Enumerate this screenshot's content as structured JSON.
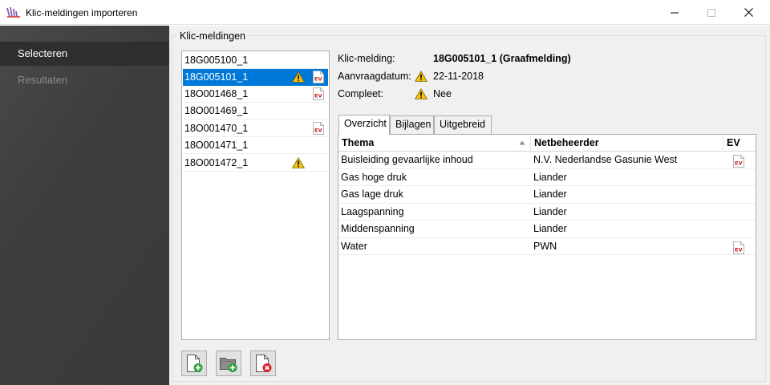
{
  "window": {
    "title": "Klic-meldingen importeren"
  },
  "nav": {
    "items": [
      {
        "label": "Selecteren"
      },
      {
        "label": "Resultaten"
      }
    ]
  },
  "group": {
    "label": "Klic-meldingen"
  },
  "list": {
    "items": [
      {
        "label": "18G005100_1",
        "warning": false,
        "ev": false,
        "selected": false
      },
      {
        "label": "18G005101_1",
        "warning": true,
        "ev": true,
        "selected": true
      },
      {
        "label": "18O001468_1",
        "warning": false,
        "ev": true,
        "selected": false
      },
      {
        "label": "18O001469_1",
        "warning": false,
        "ev": false,
        "selected": false
      },
      {
        "label": "18O001470_1",
        "warning": false,
        "ev": true,
        "selected": false
      },
      {
        "label": "18O001471_1",
        "warning": false,
        "ev": false,
        "selected": false
      },
      {
        "label": "18O001472_1",
        "warning": true,
        "ev": false,
        "selected": false
      }
    ]
  },
  "details": {
    "melding_label": "Klic-melding:",
    "melding_value": "18G005101_1 (Graafmelding)",
    "datum_label": "Aanvraagdatum:",
    "datum_value": "22-11-2018",
    "compleet_label": "Compleet:",
    "compleet_value": "Nee"
  },
  "tabs": [
    {
      "label": "Overzicht",
      "active": true
    },
    {
      "label": "Bijlagen",
      "active": false
    },
    {
      "label": "Uitgebreid",
      "active": false
    }
  ],
  "grid": {
    "columns": [
      {
        "label": "Thema",
        "sorted": "ascending"
      },
      {
        "label": "Netbeheerder"
      },
      {
        "label": "EV"
      }
    ],
    "rows": [
      {
        "thema": "Buisleiding gevaarlijke inhoud",
        "netbeheerder": "N.V. Nederlandse Gasunie West",
        "ev": true
      },
      {
        "thema": "Gas hoge druk",
        "netbeheerder": "Liander",
        "ev": false
      },
      {
        "thema": "Gas lage druk",
        "netbeheerder": "Liander",
        "ev": false
      },
      {
        "thema": "Laagspanning",
        "netbeheerder": "Liander",
        "ev": false
      },
      {
        "thema": "Middenspanning",
        "netbeheerder": "Liander",
        "ev": false
      },
      {
        "thema": "Water",
        "netbeheerder": "PWN",
        "ev": true
      }
    ]
  },
  "icons": {
    "app": "klic-app-icon",
    "warning": "warning-icon",
    "ev": "ev-document-icon",
    "buttons": [
      "add-file-icon",
      "add-folder-icon",
      "remove-file-icon"
    ]
  },
  "colors": {
    "selection": "#0078d7",
    "sidebar": "#3d3d3d",
    "warning": "#f5c211",
    "ev": "#c41f1f",
    "add": "#2aa33a",
    "remove": "#d9232d"
  }
}
